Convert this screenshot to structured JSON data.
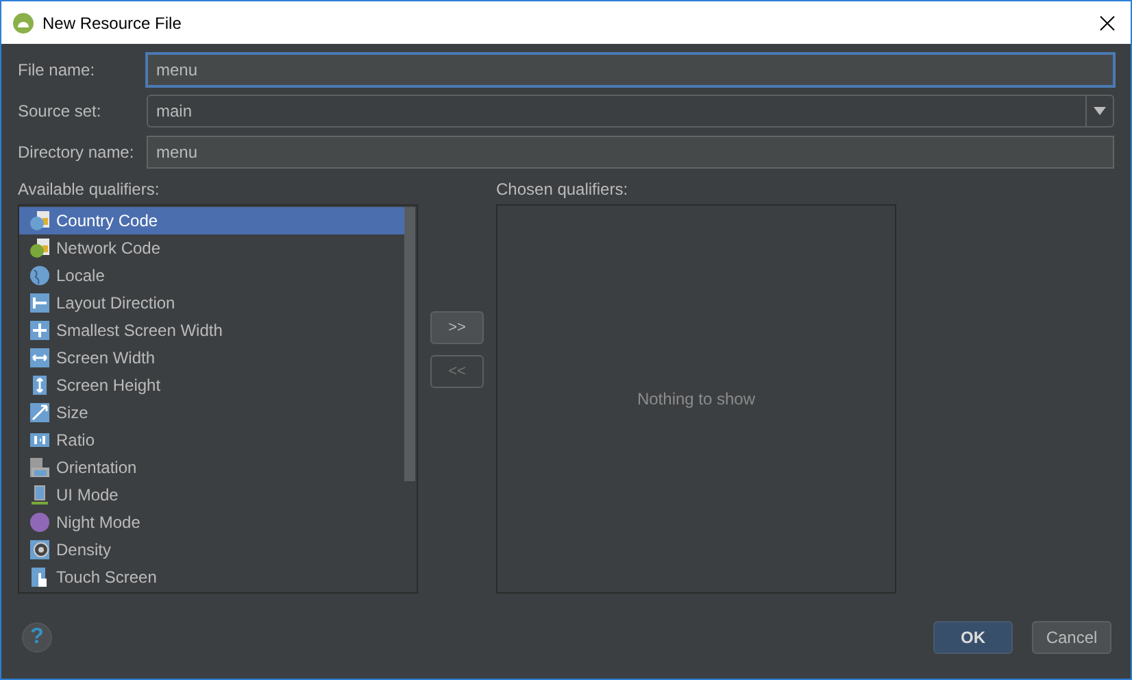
{
  "window": {
    "title": "New Resource File"
  },
  "fields": [
    {
      "kind": "text",
      "label": "File name:",
      "value": "menu",
      "focused": true
    },
    {
      "kind": "dropdown",
      "label": "Source set:",
      "value": "main",
      "focused": false
    },
    {
      "kind": "text",
      "label": "Directory name:",
      "value": "menu",
      "focused": false
    }
  ],
  "available_qualifiers": {
    "label": "Available qualifiers:",
    "items": [
      {
        "label": "Country Code",
        "selected": true
      },
      {
        "label": "Network Code",
        "selected": false
      },
      {
        "label": "Locale",
        "selected": false
      },
      {
        "label": "Layout Direction",
        "selected": false
      },
      {
        "label": "Smallest Screen Width",
        "selected": false
      },
      {
        "label": "Screen Width",
        "selected": false
      },
      {
        "label": "Screen Height",
        "selected": false
      },
      {
        "label": "Size",
        "selected": false
      },
      {
        "label": "Ratio",
        "selected": false
      },
      {
        "label": "Orientation",
        "selected": false
      },
      {
        "label": "UI Mode",
        "selected": false
      },
      {
        "label": "Night Mode",
        "selected": false
      },
      {
        "label": "Density",
        "selected": false
      },
      {
        "label": "Touch Screen",
        "selected": false
      }
    ]
  },
  "transfer_buttons": [
    {
      "label": ">>",
      "disabled": false
    },
    {
      "label": "<<",
      "disabled": true
    }
  ],
  "chosen_qualifiers": {
    "label": "Chosen qualifiers:",
    "empty_text": "Nothing to show"
  },
  "help": {
    "label": "?"
  },
  "buttons": [
    {
      "label": "OK",
      "kind": "default"
    },
    {
      "label": "Cancel",
      "kind": "normal"
    }
  ]
}
